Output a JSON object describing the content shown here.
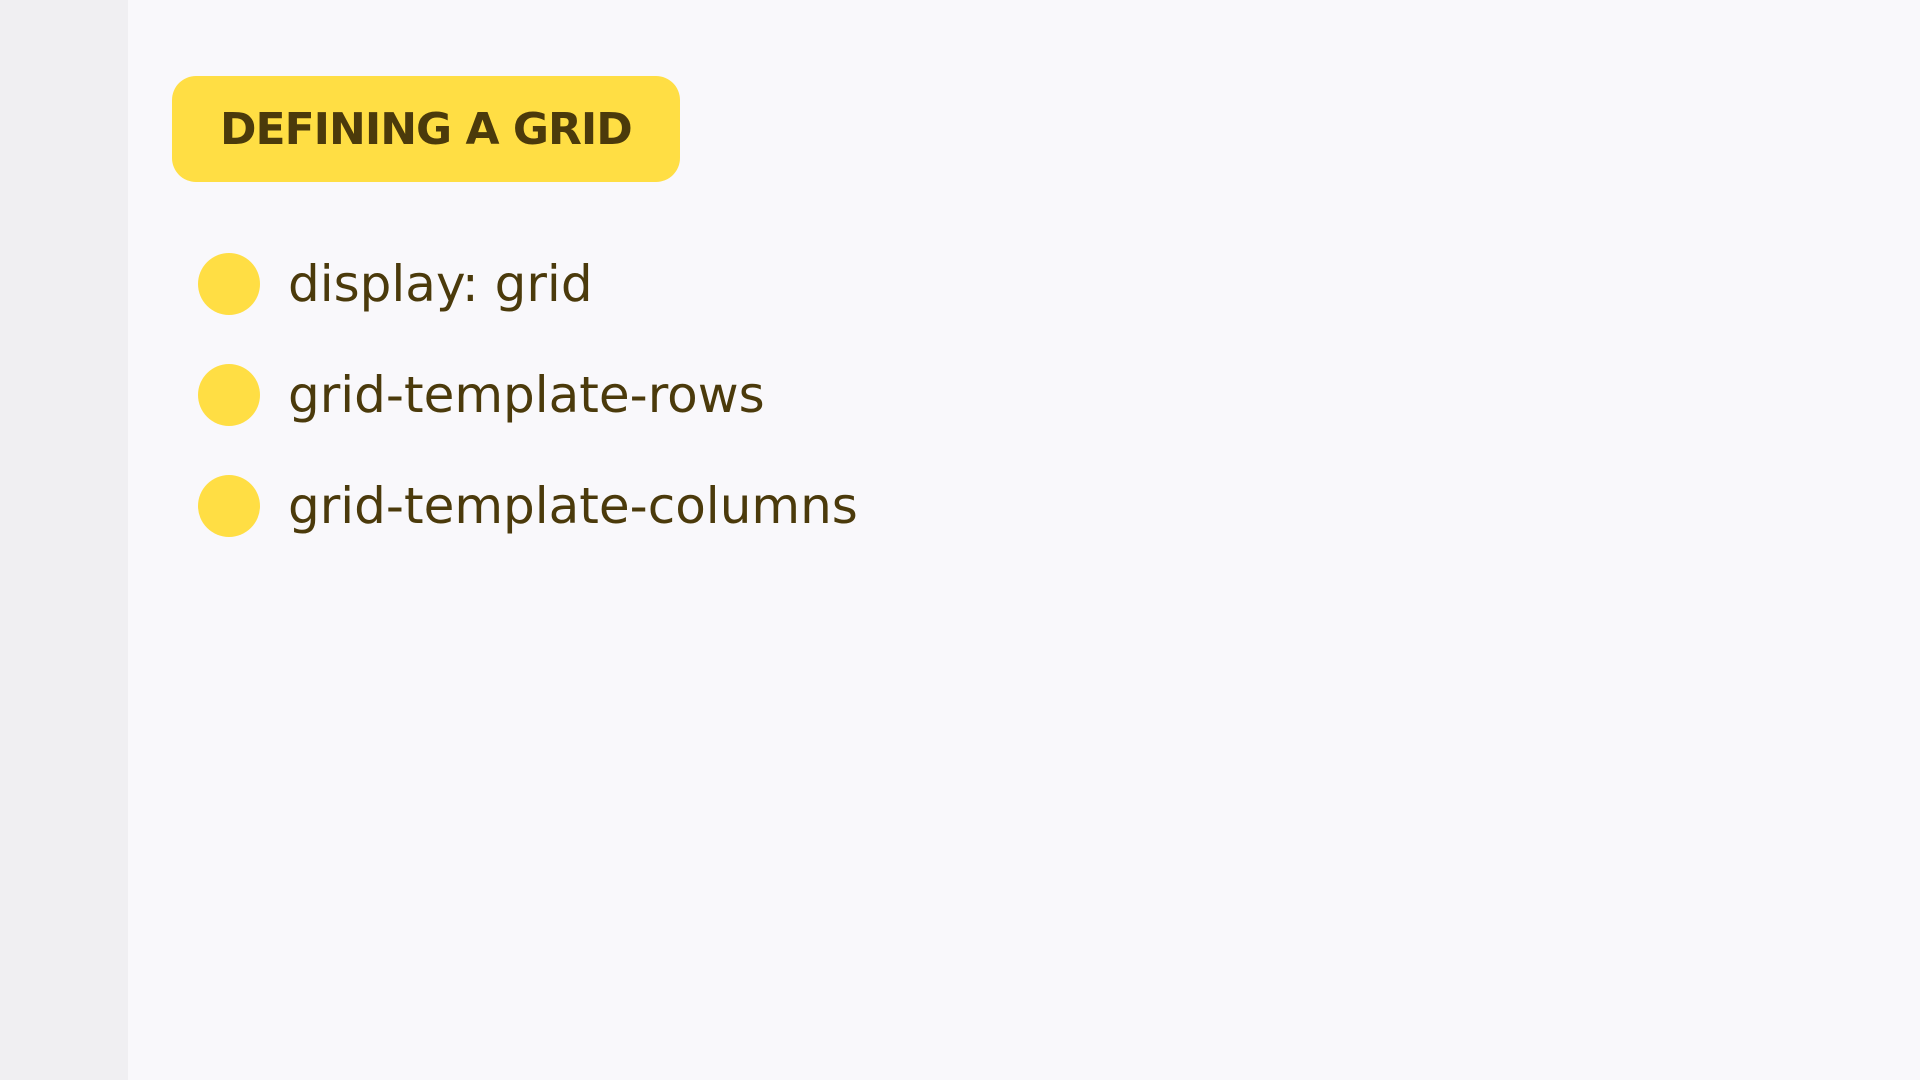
{
  "colors": {
    "accent": "#ffde44",
    "text": "#4b3a0b",
    "background": "#f9f8fb",
    "rail": "#f0eff2"
  },
  "slide": {
    "badge": "DEFINING A GRID",
    "bullets": [
      {
        "text": "display: grid"
      },
      {
        "text": "grid-template-rows"
      },
      {
        "text": "grid-template-columns"
      }
    ]
  }
}
